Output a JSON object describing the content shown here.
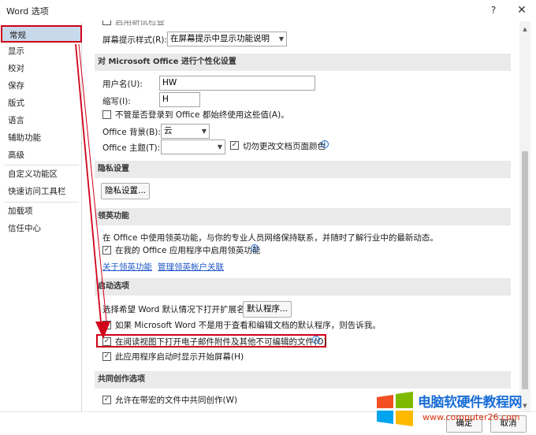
{
  "window": {
    "title": "Word 选项",
    "help_glyph": "?",
    "close_glyph": "✕"
  },
  "nav": {
    "items": [
      {
        "label": "常规"
      },
      {
        "label": "显示"
      },
      {
        "label": "校对"
      },
      {
        "label": "保存"
      },
      {
        "label": "版式"
      },
      {
        "label": "语言"
      },
      {
        "label": "辅助功能"
      },
      {
        "label": "高级"
      },
      {
        "label": "自定义功能区"
      },
      {
        "label": "快速访问工具栏"
      },
      {
        "label": "加载项"
      },
      {
        "label": "信任中心"
      }
    ]
  },
  "main": {
    "top_partial_label": "启用新试检查",
    "screentip_label": "屏幕提示样式(R):",
    "screentip_value": "在屏幕提示中显示功能说明",
    "personalize": {
      "header": "对 Microsoft Office 进行个性化设置",
      "username_label": "用户名(U):",
      "username_value": "HW",
      "initials_label": "缩写(I):",
      "initials_value": "H",
      "always_use_label": "不管是否登录到 Office 都始终使用这些值(A)。",
      "background_label": "Office 背景(B):",
      "background_value": "云",
      "theme_label": "Office 主题(T):",
      "theme_value": "",
      "never_change_label": "切勿更改文档页面颜色"
    },
    "privacy": {
      "header": "隐私设置",
      "button": "隐私设置..."
    },
    "linkedin": {
      "header": "领英功能",
      "desc": "在 Office 中使用领英功能，与你的专业人员网络保持联系，并随时了解行业中的最新动态。",
      "enable_label": "在我的 Office 应用程序中启用领英功能",
      "about_link": "关于领英功能",
      "manage_link": "管理领英帐户关联"
    },
    "startup": {
      "header": "启动选项",
      "choose_label": "选择希望 Word 默认情况下打开扩展名:",
      "default_programs_button": "默认程序...",
      "not_default_label": "如果 Microsoft Word 不是用于查看和编辑文档的默认程序，则告诉我。",
      "reading_view_label": "在阅读视图下打开电子邮件附件及其他不可编辑的文件(O)",
      "start_screen_label": "此应用程序启动时显示开始屏幕(H)"
    },
    "coauthor": {
      "header": "共同创作选项",
      "allow_label": "允许在带宏的文件中共同创作(W)"
    },
    "check_glyph": "✓",
    "info_glyph": "i"
  },
  "footer": {
    "ok_label": "确定",
    "cancel_label": "取消"
  },
  "watermark": {
    "title": "电脑软硬件教程网",
    "url": "www.computer26.com"
  },
  "colors": {
    "highlight_red": "#d0021b",
    "selected_nav": "#c9d9ec",
    "link_blue": "#1f57c7"
  }
}
